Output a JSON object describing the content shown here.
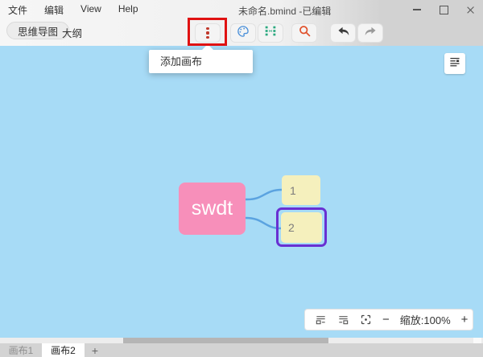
{
  "window": {
    "menu": [
      "文件",
      "编辑",
      "View",
      "Help"
    ],
    "title": "未命名.bmind -已编辑"
  },
  "toolbar": {
    "view_tabs": [
      {
        "label": "思维导图",
        "active": true
      },
      {
        "label": "大纲",
        "active": false
      }
    ],
    "buttons": [
      "more-options",
      "theme-palette",
      "structure",
      "search",
      "undo",
      "redo"
    ]
  },
  "popup": {
    "label": "添加画布"
  },
  "mindmap": {
    "root": {
      "text": "swdt",
      "color": "#f78fba"
    },
    "children": [
      {
        "text": "1",
        "color": "#f5f0bd",
        "selected": false
      },
      {
        "text": "2",
        "color": "#f5f0bd",
        "selected": true
      }
    ],
    "selection_color": "#6930d2",
    "connector_color": "#5ba3e0",
    "canvas_color": "#a7dbf6"
  },
  "zoom_bar": {
    "minus": "−",
    "label": "缩放:100%",
    "plus": "+"
  },
  "bottom_bar": {
    "tabs": [
      {
        "label": "画布1",
        "active": false
      },
      {
        "label": "画布2",
        "active": true
      }
    ],
    "add": "+"
  },
  "annotation": {
    "color": "#e01212"
  }
}
